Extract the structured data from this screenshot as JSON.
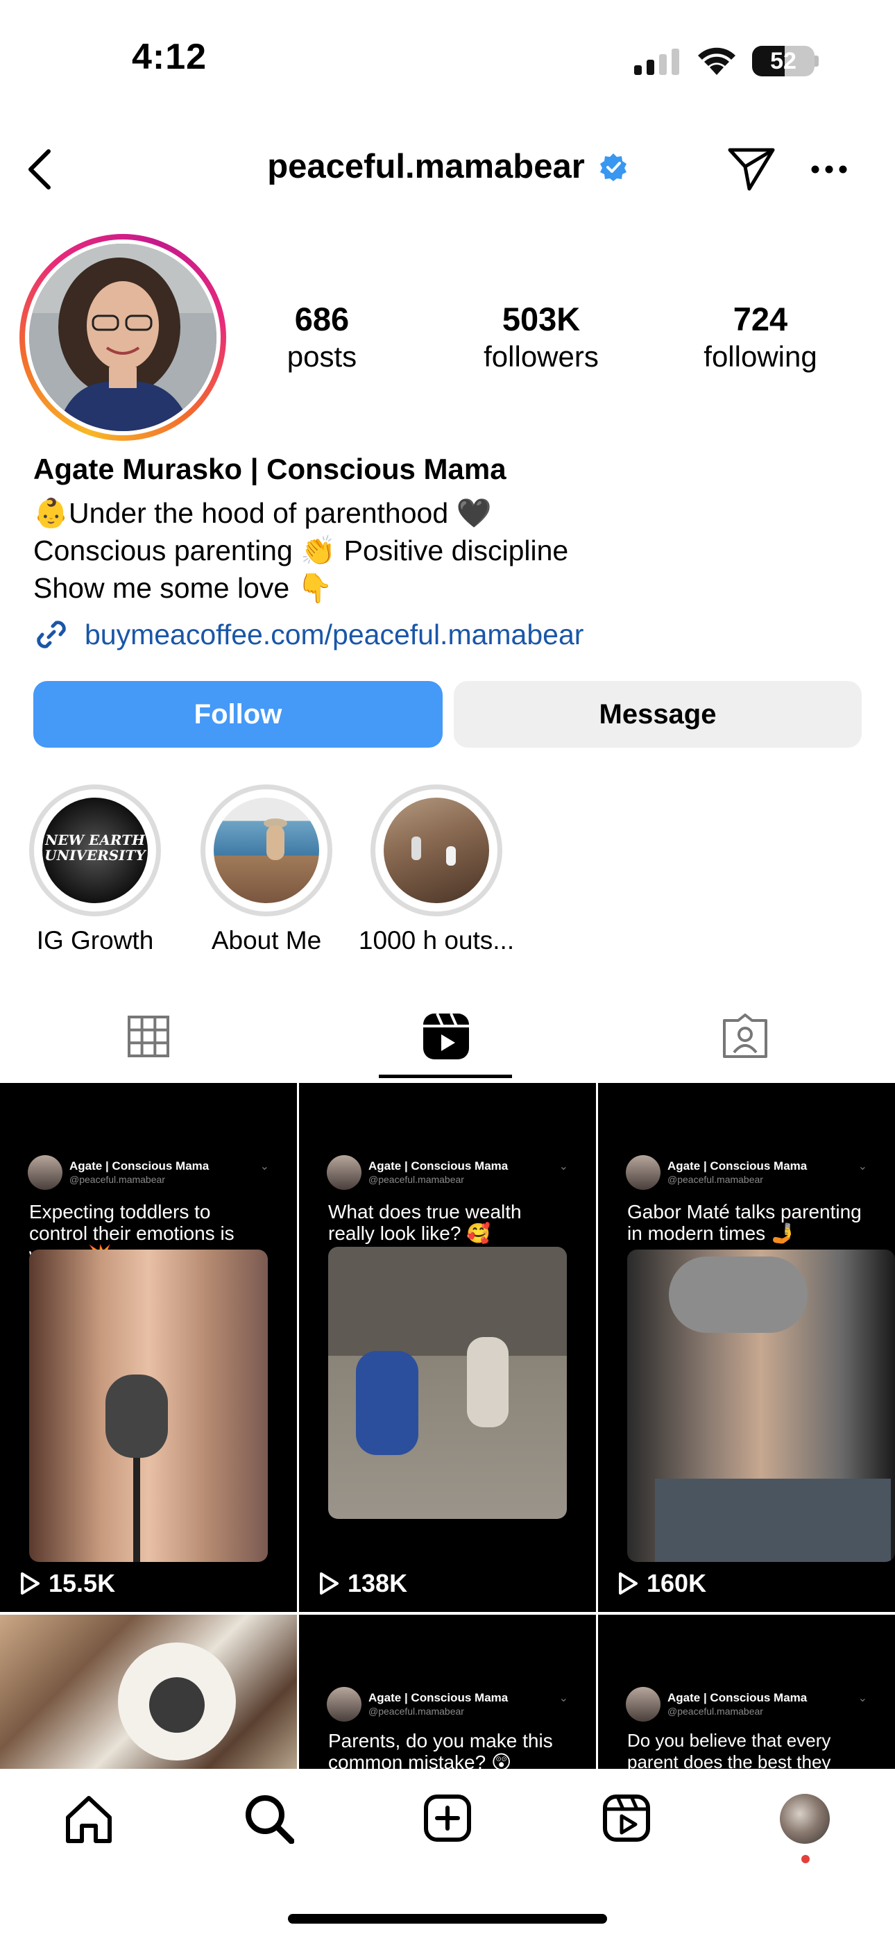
{
  "status_bar": {
    "time": "4:12",
    "battery": "52",
    "battery_level": 0.52
  },
  "header": {
    "username": "peaceful.mamabear",
    "verified": true
  },
  "profile": {
    "stats": [
      {
        "number": "686",
        "label": "posts"
      },
      {
        "number": "503K",
        "label": "followers"
      },
      {
        "number": "724",
        "label": "following"
      }
    ],
    "display_name": "Agate Murasko | Conscious Mama",
    "bio_lines": [
      "👶Under the hood of parenthood 🖤",
      "Conscious parenting 👏 Positive discipline",
      "Show me some love 👇"
    ],
    "link": "buymeacoffee.com/peaceful.mamabear"
  },
  "actions": {
    "follow": "Follow",
    "message": "Message"
  },
  "highlights": [
    {
      "label": "IG Growth",
      "art_text": "NEW EARTH UNIVERSITY"
    },
    {
      "label": "About Me"
    },
    {
      "label": "1000 h outs..."
    }
  ],
  "tabs": [
    "grid-icon",
    "reels-icon",
    "tagged-icon"
  ],
  "reels": [
    {
      "account": "Agate | Conscious Mama",
      "handle": "@peaceful.mamabear",
      "caption": "Expecting toddlers to control their emotions is wrong 💥",
      "views": "15.5K"
    },
    {
      "account": "Agate | Conscious Mama",
      "handle": "@peaceful.mamabear",
      "caption": "What does true wealth really look like? 🥰",
      "views": "138K"
    },
    {
      "account": "Agate | Conscious Mama",
      "handle": "@peaceful.mamabear",
      "caption": "Gabor Maté talks parenting in modern times 🤳",
      "views": "160K"
    },
    {
      "account": "",
      "handle": "",
      "caption": "",
      "views": ""
    },
    {
      "account": "Agate | Conscious Mama",
      "handle": "@peaceful.mamabear",
      "caption": "Parents, do you make this common mistake? 😲",
      "views": ""
    },
    {
      "account": "Agate | Conscious Mama",
      "handle": "@peaceful.mamabear",
      "caption": "Do you believe that every parent does the best they can?",
      "views": ""
    }
  ],
  "bottom_nav": [
    "home-icon",
    "search-icon",
    "create-icon",
    "reels-icon",
    "profile-avatar"
  ],
  "colors": {
    "follow_blue": "#4599f7",
    "link_blue": "#1a56a8",
    "verified_blue": "#3897f0",
    "notification_dot": "#e4403b"
  }
}
